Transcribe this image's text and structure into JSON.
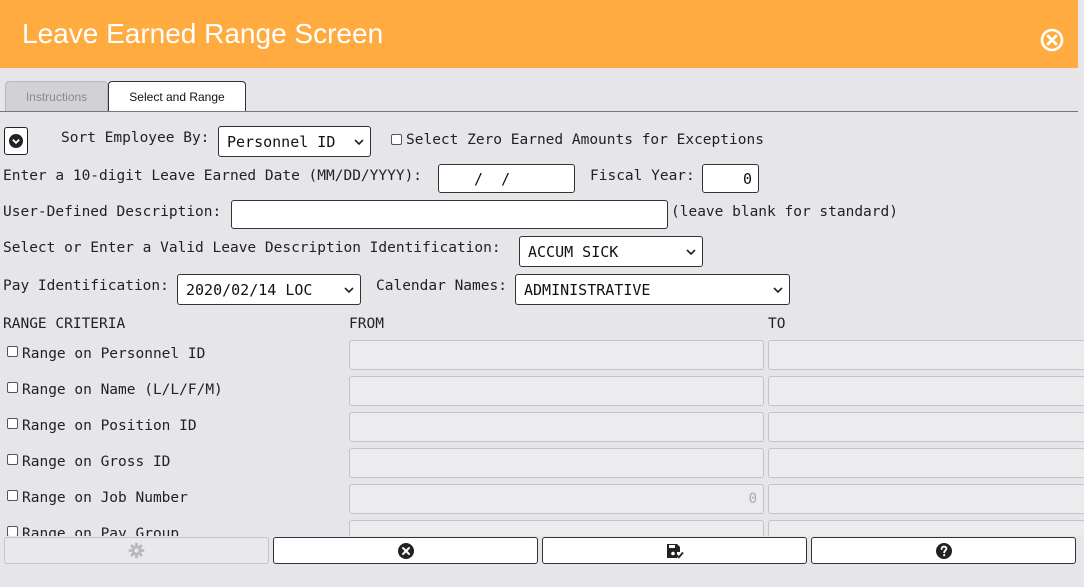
{
  "header": {
    "title": "Leave Earned Range Screen",
    "close_icon": "close-circle-icon"
  },
  "tabs": [
    {
      "label": "Instructions",
      "active": false
    },
    {
      "label": "Select and Range",
      "active": true
    }
  ],
  "form": {
    "sort_label": "Sort Employee By:",
    "sort_value": "Personnel ID",
    "zero_earned_label": "Select Zero Earned Amounts for Exceptions",
    "date_label": "Enter a 10-digit Leave Earned Date (MM/DD/YYYY):",
    "date_value": " /  /",
    "fiscal_year_label": "Fiscal Year:",
    "fiscal_year_value": "0",
    "desc_label": "User-Defined Description:",
    "desc_value": "",
    "desc_hint": "(leave blank for standard)",
    "leave_desc_label": "Select or Enter a Valid Leave Description Identification:",
    "leave_desc_value": "ACCUM SICK",
    "pay_id_label": "Pay Identification:",
    "pay_id_value": "2020/02/14 LOC",
    "calendar_label": "Calendar Names:",
    "calendar_value": "ADMINISTRATIVE"
  },
  "range": {
    "header": "RANGE CRITERIA",
    "from_header": "FROM",
    "to_header": "TO",
    "rows": [
      {
        "label": "Range on Personnel ID",
        "from": "",
        "to": ""
      },
      {
        "label": "Range on Name (L/L/F/M)",
        "from": "",
        "to": ""
      },
      {
        "label": "Range on Position ID",
        "from": "",
        "to": ""
      },
      {
        "label": "Range on Gross ID",
        "from": "",
        "to": ""
      },
      {
        "label": "Range on Job Number",
        "from": "0",
        "to": ""
      },
      {
        "label": "Range on Pay Group",
        "from": "",
        "to": ""
      }
    ]
  },
  "footer": {
    "buttons": [
      {
        "icon": "gear-icon",
        "disabled": true
      },
      {
        "icon": "cancel-circle-icon",
        "disabled": false
      },
      {
        "icon": "save-check-icon",
        "disabled": false
      },
      {
        "icon": "help-circle-icon",
        "disabled": false
      }
    ]
  },
  "colors": {
    "header_bg": "#ffab40",
    "page_bg": "#e6e5ea"
  }
}
